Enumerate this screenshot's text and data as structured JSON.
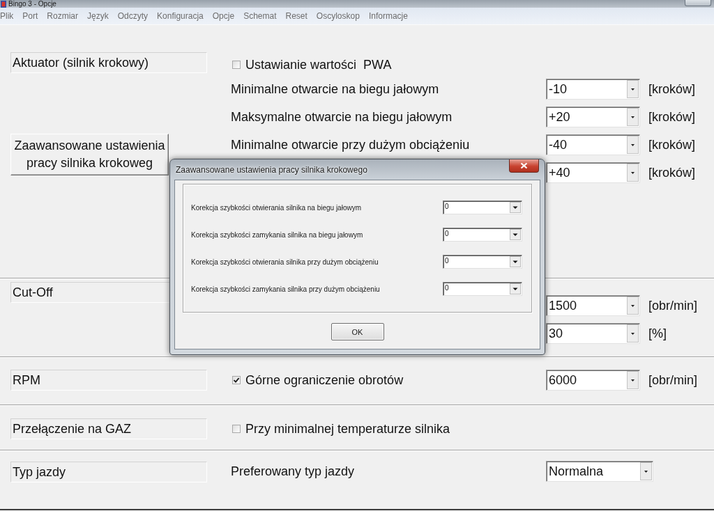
{
  "window": {
    "title": "Bingo 3 - Opcje"
  },
  "menu": [
    "Plik",
    "Port",
    "Rozmiar",
    "Język",
    "Odczyty",
    "Konfiguracja",
    "Opcje",
    "Schemat",
    "Reset",
    "Oscyloskop",
    "Informacje"
  ],
  "sections": [
    {
      "title": "Aktuator (silnik krokowy)",
      "button": "Zaawansowane ustawienia pracy silnika krokoweg",
      "rows": [
        {
          "kind": "checkbox",
          "label": "Ustawianie wartości  PWA",
          "checked": false
        },
        {
          "kind": "combo",
          "label": "Minimalne otwarcie na biegu jałowym",
          "value": "-10",
          "unit": "[kroków]"
        },
        {
          "kind": "combo",
          "label": "Maksymalne otwarcie na biegu jałowym",
          "value": "+20",
          "unit": "[kroków]"
        },
        {
          "kind": "combo",
          "label": "Minimalne otwarcie przy dużym obciążeniu",
          "value": "-40",
          "unit": "[kroków]"
        },
        {
          "kind": "combo",
          "value": "+40",
          "unit": "[kroków]"
        }
      ]
    },
    {
      "title": "Cut-Off",
      "rows": [
        {
          "kind": "combo",
          "value": "1500",
          "unit": "[obr/min]"
        },
        {
          "kind": "combo",
          "value": "30",
          "unit": "[%]"
        }
      ]
    },
    {
      "title": "RPM",
      "rows": [
        {
          "kind": "checkbox_combo",
          "label": "Górne ograniczenie obrotów",
          "checked": true,
          "value": "6000",
          "unit": "[obr/min]"
        }
      ]
    },
    {
      "title": "Przełączenie na GAZ",
      "rows": [
        {
          "kind": "checkbox",
          "label": "Przy minimalnej temperaturze silnika",
          "checked": false
        }
      ]
    },
    {
      "title": "Typ jazdy",
      "rows": [
        {
          "kind": "combo",
          "label": "Preferowany typ jazdy",
          "value": "Normalna"
        }
      ]
    }
  ],
  "dialog": {
    "title": "Zaawansowane ustawienia pracy silnika krokowego",
    "rows": [
      {
        "label": "Korekcja szybkości otwierania silnika na biegu jałowym",
        "value": "0"
      },
      {
        "label": "Korekcja szybkości zamykania silnika na biegu jałowym",
        "value": "0"
      },
      {
        "label": "Korekcja szybkości otwierania silnika przy dużym obciążeniu",
        "value": "0"
      },
      {
        "label": "Korekcja szybkości zamykania silnika przy dużym obciążeniu",
        "value": "0"
      }
    ],
    "ok_button": "OK"
  }
}
